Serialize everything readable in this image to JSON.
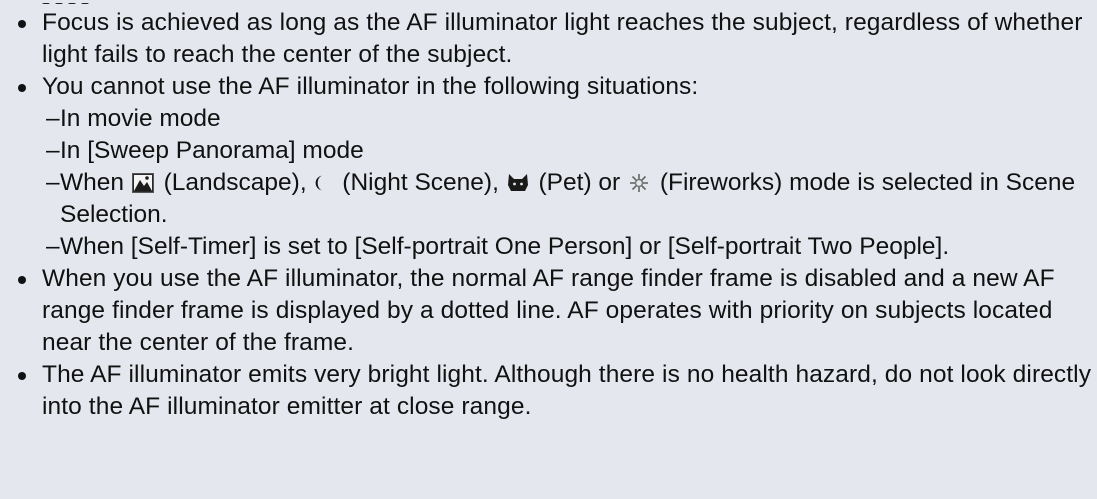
{
  "notes": [
    {
      "text": "Focus is achieved as long as the AF illuminator light reaches the subject, regardless of whether light fails to reach the center of the subject."
    },
    {
      "text": "You cannot use the AF illuminator in the following situations:",
      "sub_items": [
        "In movie mode",
        "In [Sweep Panorama] mode",
        {
          "before_landscape": "When",
          "landscape": "(Landscape),",
          "night": "(Night Scene),",
          "pet": "(Pet) or",
          "fireworks": "(Fireworks) mode is selected in Scene Selection."
        },
        "When [Self-Timer] is set to [Self-portrait One Person] or [Self-portrait Two People]."
      ]
    },
    {
      "text": "When you use the AF illuminator, the normal AF range finder frame is disabled and a new AF range finder frame is displayed by a dotted line. AF operates with priority on subjects located near the center of the frame."
    },
    {
      "text": "The AF illuminator emits very bright light. Although there is no health hazard, do not look directly into the AF illuminator emitter at close range."
    }
  ],
  "dash_glyph": "–",
  "icons": {
    "landscape": "landscape-icon",
    "night": "night-scene-icon",
    "pet": "pet-icon",
    "fireworks": "fireworks-icon"
  }
}
